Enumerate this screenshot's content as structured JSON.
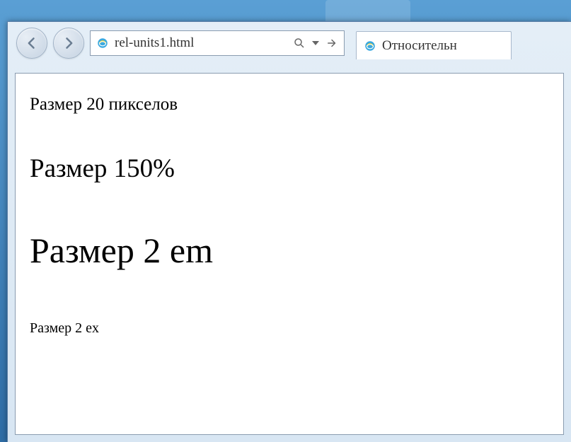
{
  "browser": {
    "url": "rel-units1.html",
    "tab_title": "Относительн"
  },
  "page": {
    "line1": "Размер 20 пикселов",
    "line2": "Размер 150%",
    "line3": "Размер 2 em",
    "line4": "Размер 2 ex"
  }
}
